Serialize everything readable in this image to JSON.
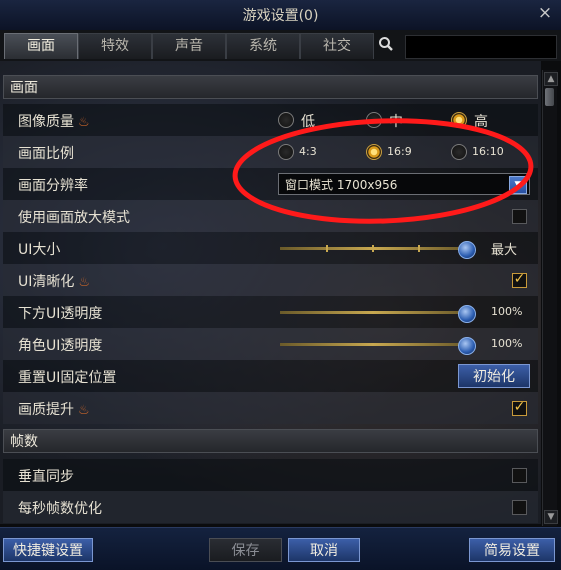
{
  "window": {
    "title": "游戏设置(0)",
    "close_label": "×"
  },
  "tabs": [
    {
      "label": "画面",
      "active": true
    },
    {
      "label": "特效",
      "active": false
    },
    {
      "label": "声音",
      "active": false
    },
    {
      "label": "系统",
      "active": false
    },
    {
      "label": "社交",
      "active": false
    }
  ],
  "search": {
    "icon": "search-icon",
    "value": ""
  },
  "sections": {
    "display": {
      "title": "画面"
    },
    "framerate": {
      "title": "帧数"
    }
  },
  "rows": {
    "image_quality": {
      "label": "图像质量",
      "options": [
        "低",
        "中",
        "高"
      ],
      "selected": "高"
    },
    "aspect_ratio": {
      "label": "画面比例",
      "options": [
        "4:3",
        "16:9",
        "16:10"
      ],
      "selected": "16:9"
    },
    "resolution": {
      "label": "画面分辨率",
      "value": "窗口模式 1700x956"
    },
    "zoom_mode": {
      "label": "使用画面放大模式",
      "checked": false
    },
    "ui_size": {
      "label": "UI大小",
      "value_label": "最大",
      "level": 1.0
    },
    "ui_sharpen": {
      "label": "UI清晰化",
      "checked": true
    },
    "bottom_ui_opacity": {
      "label": "下方UI透明度",
      "value_label": "100%",
      "level": 1.0
    },
    "char_ui_opacity": {
      "label": "角色UI透明度",
      "value_label": "100%",
      "level": 1.0
    },
    "reset_ui": {
      "label": "重置UI固定位置",
      "button_label": "初始化"
    },
    "quality_boost": {
      "label": "画质提升",
      "checked": true
    },
    "vsync": {
      "label": "垂直同步",
      "checked": false
    },
    "fps_opt": {
      "label": "每秒帧数优化",
      "checked": false
    }
  },
  "footer": {
    "shortcut_label": "快捷键设置",
    "save_label": "保存",
    "cancel_label": "取消",
    "simple_label": "简易设置"
  },
  "colors": {
    "accent_blue": "#2f56a8",
    "highlight_gold": "#f0c24a",
    "annotation_red": "#ff1a1a"
  }
}
